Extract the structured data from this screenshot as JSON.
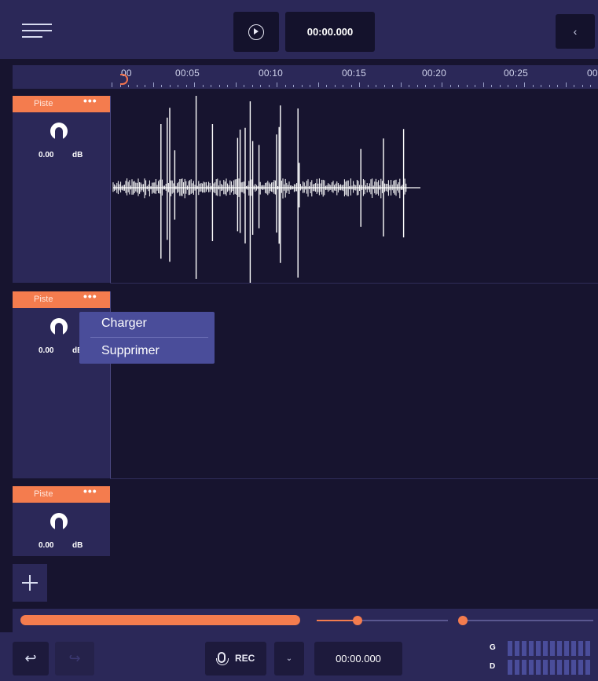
{
  "header": {
    "menu_icon": "hamburger-icon",
    "play_icon": "play-circle-icon",
    "time": "00:00.000",
    "collapse_icon": "chevron-left-icon",
    "collapse_label": "‹"
  },
  "ruler": {
    "labels": [
      "00",
      "00:05",
      "00:10",
      "00:15",
      "00:20",
      "00:25",
      "00"
    ]
  },
  "tracks": [
    {
      "name": "Piste",
      "more": "•••",
      "gain": "0.00",
      "unit": "dB",
      "knob_icon": "gain-knob-icon",
      "has_audio": true
    },
    {
      "name": "Piste",
      "more": "•••",
      "gain": "0.00",
      "unit": "dB",
      "knob_icon": "gain-knob-icon",
      "has_audio": false
    },
    {
      "name": "Piste",
      "more": "•••",
      "gain": "0.00",
      "unit": "dB",
      "knob_icon": "gain-knob-icon",
      "has_audio": false
    }
  ],
  "context_menu": {
    "items": [
      "Charger",
      "Supprimer"
    ]
  },
  "add_track_icon": "plus-icon",
  "transport": {
    "undo_icon": "undo-icon",
    "undo_label": "↩",
    "redo_icon": "redo-icon",
    "redo_label": "↪",
    "rec_icon": "microphone-icon",
    "rec_label": "REC",
    "rec_options_label": "⌄",
    "rec_time": "00:00.000",
    "meter_left_label": "G",
    "meter_right_label": "D"
  },
  "colors": {
    "accent": "#f47c4e",
    "panel": "#2b2858",
    "background": "#17142f",
    "menu": "#4a4d9a"
  }
}
